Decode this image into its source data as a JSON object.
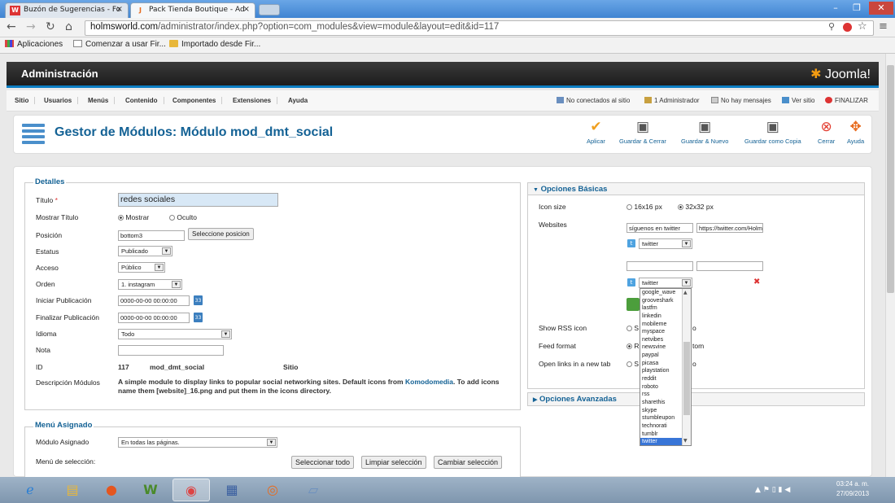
{
  "browser": {
    "tabs": [
      {
        "icon": "W",
        "label": "Buzón de Sugerencias - Fo"
      },
      {
        "icon": "J",
        "label": "Pack Tienda Boutique - Ad"
      }
    ],
    "url_host": "holmsworld.com",
    "url_path": "/administrator/index.php?option=com_modules&view=module&layout=edit&id=117",
    "bookmarks": [
      "Aplicaciones",
      "Comenzar a usar Fir...",
      "Importado desde Fir..."
    ],
    "window_controls": [
      "–",
      "❐",
      "✕"
    ]
  },
  "header": {
    "title": "Administración",
    "logo": "Joomla!"
  },
  "menu": [
    "Sitio",
    "Usuarios",
    "Menús",
    "Contenido",
    "Componentes",
    "Extensiones",
    "Ayuda"
  ],
  "status": {
    "not_connected": "No conectados al sitio",
    "admins": "1 Administrador",
    "messages": "No hay mensajes",
    "view_site": "Ver sitio",
    "logout": "FINALIZAR"
  },
  "toolbar": {
    "page_title": "Gestor de Módulos: Módulo mod_dmt_social",
    "buttons": [
      "Aplicar",
      "Guardar & Cerrar",
      "Guardar & Nuevo",
      "Guardar como Copia",
      "Cerrar",
      "Ayuda"
    ]
  },
  "details": {
    "legend": "Detalles",
    "title_label": "Título",
    "title_required": "*",
    "title_value": "redes sociales",
    "show_title_label": "Mostrar Título",
    "show_option": "Mostrar",
    "hide_option": "Oculto",
    "position_label": "Posición",
    "position_value": "bottom3",
    "position_button": "Seleccione posicion",
    "status_label": "Estatus",
    "status_value": "Publicado",
    "access_label": "Acceso",
    "access_value": "Público",
    "order_label": "Orden",
    "order_value": "1. instagram",
    "start_label": "Iniciar Publicación",
    "start_value": "0000-00-00 00:00:00",
    "finish_label": "Finalizar Publicación",
    "finish_value": "0000-00-00 00:00:00",
    "calendar_icon_text": "33",
    "language_label": "Idioma",
    "language_value": "Todo",
    "note_label": "Nota",
    "id_label": "ID",
    "id_value": "117",
    "id_module": "mod_dmt_social",
    "id_site": "Sitio",
    "desc_label": "Descripción Módulos",
    "desc_text_1": "A simple module to display links to popular social networking sites. Default icons from",
    "desc_link": "Komodomedia",
    "desc_text_2": ". To add icons name them [website]_16.png and put them in the icons directory."
  },
  "menu_assign": {
    "legend": "Menú Asignado",
    "module_label": "Módulo Asignado",
    "module_value": "En todas las páginas.",
    "selection_label": "Menú de selección:",
    "buttons": [
      "Seleccionar todo",
      "Limpiar selección",
      "Cambiar selección"
    ]
  },
  "basic": {
    "header": "Opciones Básicas",
    "icon_size_label": "Icon size",
    "size_16": "16x16 px",
    "size_32": "32x32 px",
    "websites_label": "Websites",
    "site1_text": "síguenos en twitter",
    "site1_url": "https://twitter.com/Holm",
    "site1_select": "twitter",
    "site2_select": "twitter",
    "rss_label": "Show RSS icon",
    "rss_partial_left": "S",
    "rss_partial_right": "o",
    "feed_label": "Feed format",
    "feed_partial_left": "R",
    "feed_partial_right": "tom",
    "newtab_label": "Open links in a new tab",
    "newtab_partial_left": "S",
    "newtab_partial_right": "o",
    "remove_icon": "✖",
    "twitter_icon_text": "t"
  },
  "advanced": {
    "header": "Opciones Avanzadas"
  },
  "dropdown_options": [
    "google_wave",
    "grooveshark",
    "lastfm",
    "linkedin",
    "mobileme",
    "myspace",
    "netvibes",
    "newsvine",
    "paypal",
    "picasa",
    "playstation",
    "reddit",
    "roboto",
    "rss",
    "sharethis",
    "skype",
    "stumbleupon",
    "technorati",
    "tumblr",
    "twitter"
  ],
  "dropdown_selected": "twitter",
  "taskbar": {
    "time": "03:24 a. m.",
    "date": "27/09/2013"
  }
}
